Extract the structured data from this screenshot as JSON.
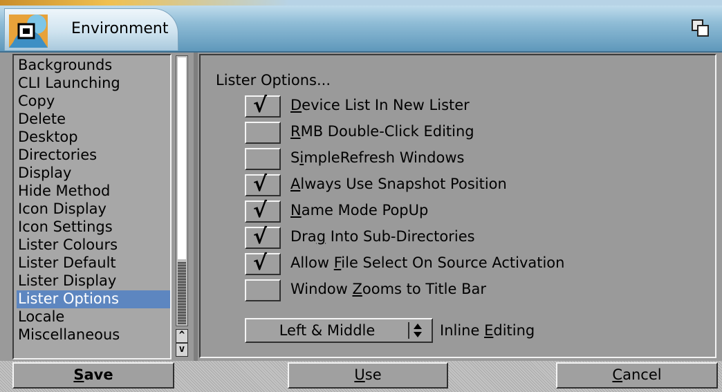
{
  "window": {
    "title": "Environment"
  },
  "icons": {
    "app": "environment-app-icon",
    "depth": "window-depth-icon",
    "scroll_up": "scroll-up-arrow-icon",
    "scroll_down": "scroll-down-arrow-icon",
    "check": "checkmark-icon",
    "cycle": "cycle-gadget-icon"
  },
  "sidebar": {
    "items": [
      {
        "label": "Backgrounds"
      },
      {
        "label": "CLI Launching"
      },
      {
        "label": "Copy"
      },
      {
        "label": "Delete"
      },
      {
        "label": "Desktop"
      },
      {
        "label": "Directories"
      },
      {
        "label": "Display"
      },
      {
        "label": "Hide Method"
      },
      {
        "label": "Icon Display"
      },
      {
        "label": "Icon Settings"
      },
      {
        "label": "Lister Colours"
      },
      {
        "label": "Lister Default"
      },
      {
        "label": "Lister Display"
      },
      {
        "label": "Lister Options",
        "selected": true
      },
      {
        "label": "Locale"
      },
      {
        "label": "Miscellaneous"
      }
    ],
    "scroll_up_glyph": "^",
    "scroll_down_glyph": "v"
  },
  "panel": {
    "heading": "Lister Options...",
    "options": [
      {
        "pre": "",
        "key": "D",
        "post": "evice List In New Lister",
        "checked": true
      },
      {
        "pre": "",
        "key": "R",
        "post": "MB Double-Click Editing",
        "checked": false
      },
      {
        "pre": "S",
        "key": "i",
        "post": "mpleRefresh Windows",
        "checked": false
      },
      {
        "pre": "",
        "key": "A",
        "post": "lways Use Snapshot Position",
        "checked": true
      },
      {
        "pre": "",
        "key": "N",
        "post": "ame Mode PopUp",
        "checked": true
      },
      {
        "pre": "Dra",
        "key": "g",
        "post": " Into Sub-Directories",
        "checked": true
      },
      {
        "pre": "Allow ",
        "key": "F",
        "post": "ile Select On Source Activation",
        "checked": true
      },
      {
        "pre": "Window ",
        "key": "Z",
        "post": "ooms to Title Bar",
        "checked": false
      }
    ],
    "inline_editing": {
      "value": "Left & Middle",
      "label_pre": "Inline ",
      "label_key": "E",
      "label_post": "diting"
    }
  },
  "buttons": {
    "save": {
      "key": "S",
      "rest": "ave"
    },
    "use": {
      "key": "U",
      "rest": "se"
    },
    "cancel": {
      "key": "C",
      "rest": "ancel"
    }
  },
  "colors": {
    "selection": "#5d86c0",
    "background": "#9a9a9a",
    "titlebar": "#5f98bb"
  }
}
